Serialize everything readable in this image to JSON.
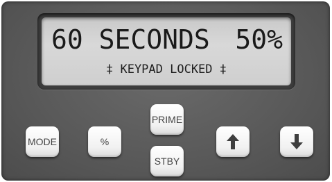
{
  "display": {
    "line1_time": "60 SECONDS",
    "line1_percent": "50%",
    "line2_status": "‡ KEYPAD LOCKED ‡"
  },
  "buttons": {
    "mode_label": "MODE",
    "percent_label": "%",
    "prime_label": "PRIME",
    "stby_label": "STBY",
    "up_icon": "arrow-up-icon",
    "down_icon": "arrow-down-icon"
  },
  "colors": {
    "panel": "#5e5e5e",
    "lcd_background": "#d3d3d3",
    "lcd_text": "#1a1a1a",
    "button_face": "#f4f4f4",
    "button_text": "#444444"
  }
}
